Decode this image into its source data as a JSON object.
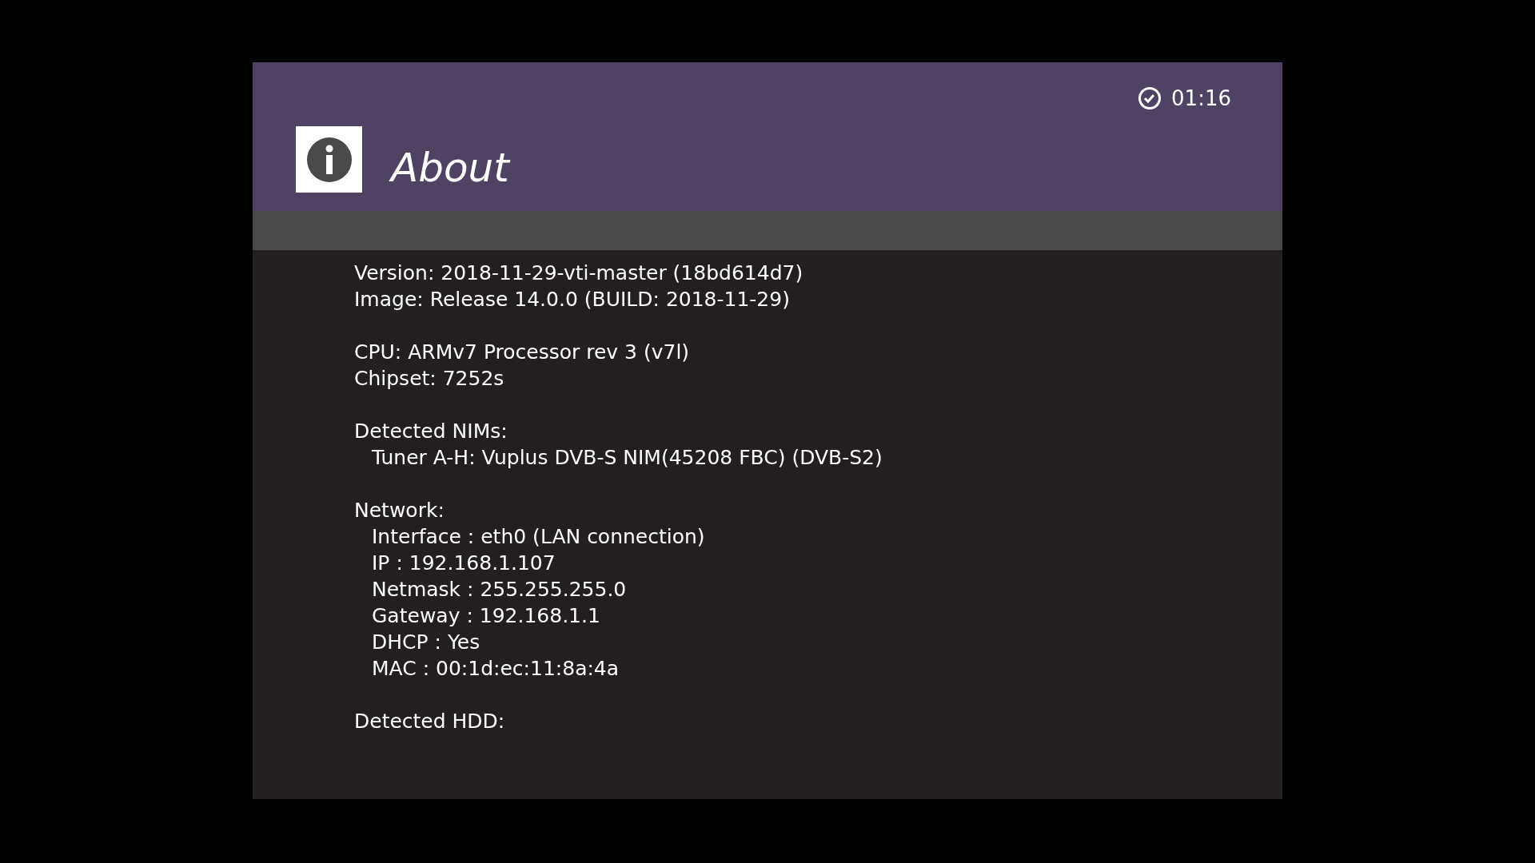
{
  "header": {
    "time": "01:16",
    "title": "About"
  },
  "groups": [
    {
      "lines": [
        {
          "text": "Version: 2018-11-29-vti-master (18bd614d7)"
        },
        {
          "text": "Image: Release 14.0.0  (BUILD: 2018-11-29)"
        }
      ]
    },
    {
      "lines": [
        {
          "text": "CPU: ARMv7 Processor rev 3 (v7l)"
        },
        {
          "text": "Chipset: 7252s"
        }
      ]
    },
    {
      "lines": [
        {
          "text": "Detected NIMs:",
          "children": [
            {
              "text": "Tuner A-H: Vuplus DVB-S NIM(45208 FBC) (DVB-S2)"
            }
          ]
        }
      ]
    },
    {
      "lines": [
        {
          "text": "Network:",
          "children": [
            {
              "text": "Interface : eth0 (LAN connection)"
            },
            {
              "text": "IP : 192.168.1.107"
            },
            {
              "text": "Netmask : 255.255.255.0"
            },
            {
              "text": "Gateway : 192.168.1.1"
            },
            {
              "text": "DHCP : Yes"
            },
            {
              "text": "MAC : 00:1d:ec:11:8a:4a"
            }
          ]
        }
      ]
    },
    {
      "lines": [
        {
          "text": "Detected HDD:"
        }
      ]
    }
  ]
}
